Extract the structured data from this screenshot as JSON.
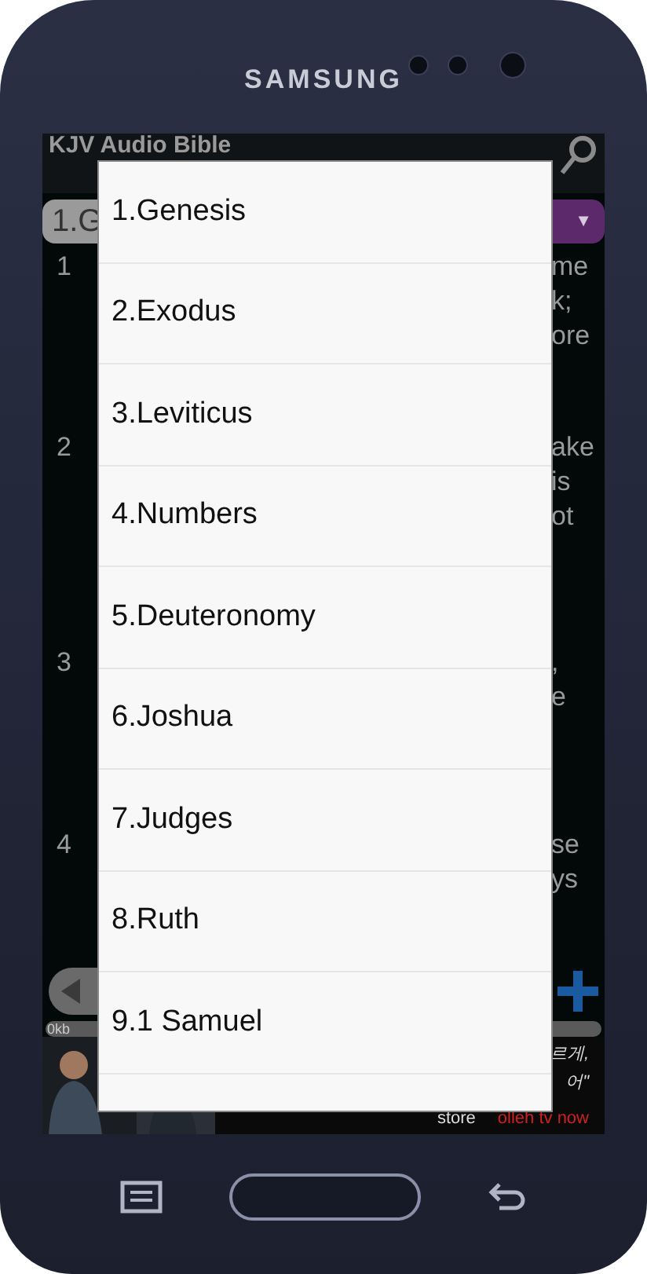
{
  "device": {
    "brand": "SAMSUNG"
  },
  "app": {
    "title": "KJV Audio Bible",
    "book_selector": "1.G",
    "dropdown_caret": "▼"
  },
  "verses": [
    {
      "number": "1",
      "lines": [
        "me",
        "k;",
        "ore"
      ]
    },
    {
      "number": "2",
      "lines": [
        "ake",
        "is",
        "ot"
      ]
    },
    {
      "number": "3",
      "lines": [
        ",",
        "e"
      ]
    },
    {
      "number": "4",
      "lines": [
        "se",
        "ys"
      ]
    }
  ],
  "progress": {
    "label": "0kb"
  },
  "ad": {
    "lines": [
      "르게,",
      "어\""
    ],
    "store": "store",
    "brand": "olleh tv now"
  },
  "dialog": {
    "items": [
      {
        "label": "1.Genesis"
      },
      {
        "label": "2.Exodus"
      },
      {
        "label": "3.Leviticus"
      },
      {
        "label": "4.Numbers"
      },
      {
        "label": "5.Deuteronomy"
      },
      {
        "label": "6.Joshua"
      },
      {
        "label": "7.Judges"
      },
      {
        "label": "8.Ruth"
      },
      {
        "label": "9.1 Samuel"
      }
    ]
  }
}
